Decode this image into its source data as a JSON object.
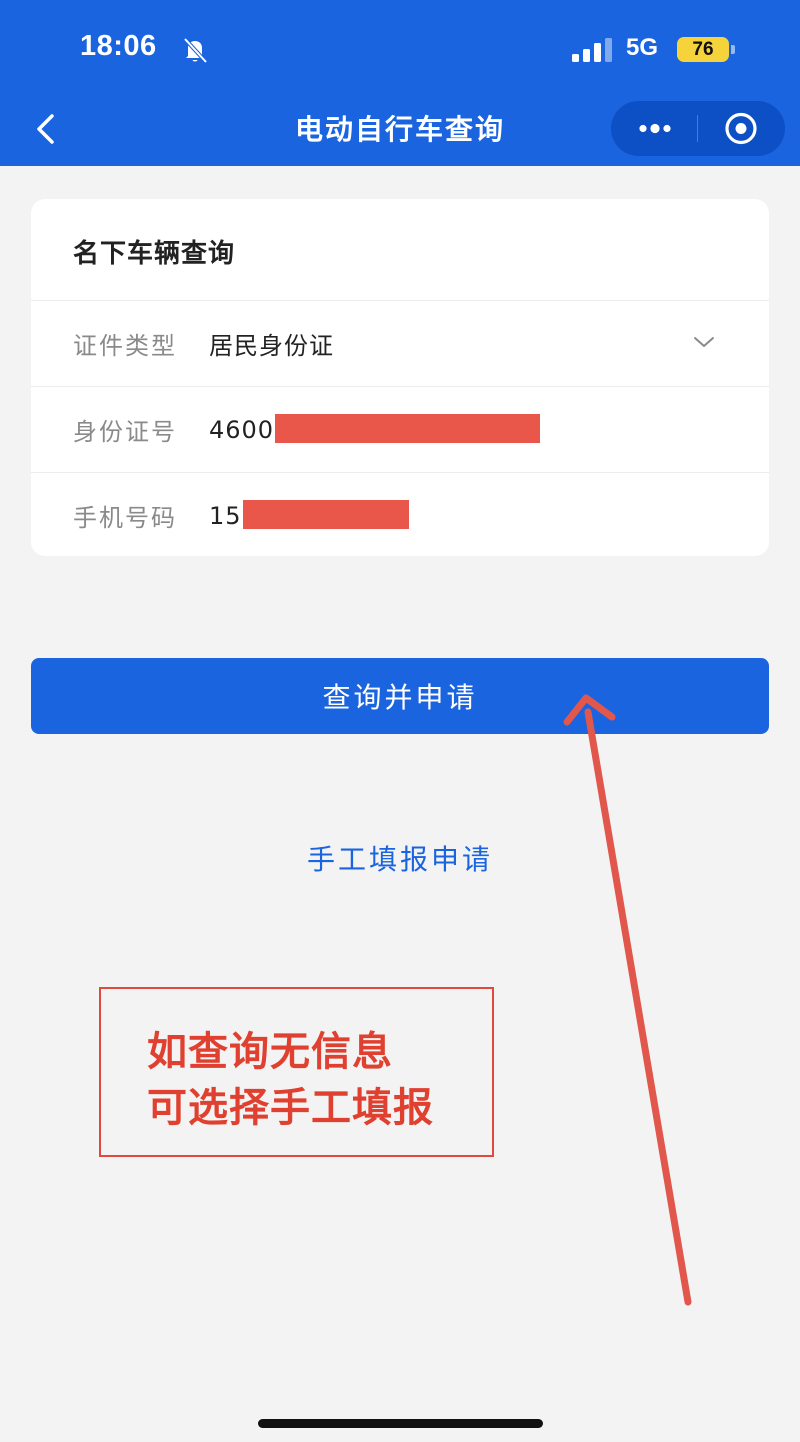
{
  "status_bar": {
    "time": "18:06",
    "network": "5G",
    "battery": "76",
    "battery_color": "#f6d23b"
  },
  "nav": {
    "title": "电动自行车查询",
    "bar_color": "#1a64e0"
  },
  "card": {
    "title": "名下车辆查询",
    "rows": [
      {
        "label": "证件类型",
        "value": "居民身份证"
      },
      {
        "label": "身份证号",
        "value": "4600"
      },
      {
        "label": "手机号码",
        "value": "15"
      }
    ]
  },
  "query_button_label": "查询并申请",
  "manual_link_label": "手工填报申请",
  "annotation": {
    "line1": "如查询无信息",
    "line2": "可选择手工填报",
    "color": "#e0402f"
  },
  "icons": [
    "mute-icon",
    "signal-icon",
    "back-icon",
    "more-icon",
    "target-icon",
    "chevron-down-icon"
  ]
}
